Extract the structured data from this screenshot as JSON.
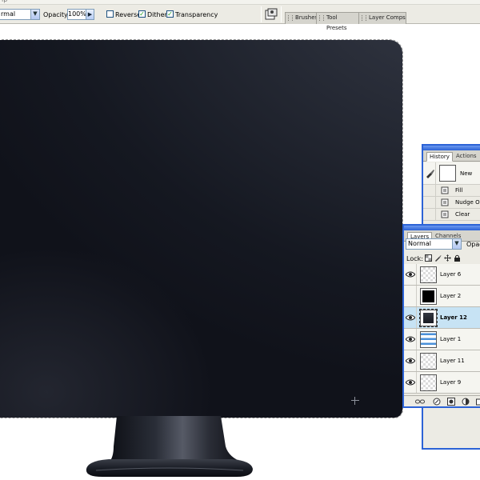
{
  "menu": {
    "fragment": "lp"
  },
  "options_bar": {
    "mode_value": "rmal",
    "opacity_label": "Opacity:",
    "opacity_value": "100%",
    "reverse_label": "Reverse",
    "reverse_checked": false,
    "dither_label": "Dither",
    "dither_checked": true,
    "transparency_label": "Transparency",
    "transparency_checked": true
  },
  "palette_well": {
    "tabs": [
      "Brushes",
      "Tool Presets",
      "Layer Comps"
    ]
  },
  "history": {
    "tabs": [
      "History",
      "Actions"
    ],
    "snapshot_label": "New",
    "steps": [
      "Fill",
      "Nudge Ou",
      "Clear"
    ]
  },
  "layers": {
    "tabs": [
      "Layers",
      "Channels"
    ],
    "blend_mode": "Normal",
    "opacity_label": "Opaci",
    "lock_label": "Lock:",
    "rows": [
      {
        "name": "Layer 6",
        "visible": true,
        "selected": false
      },
      {
        "name": "Layer 2",
        "visible": false,
        "selected": false
      },
      {
        "name": "Layer 12",
        "visible": true,
        "selected": true
      },
      {
        "name": "Layer 1",
        "visible": true,
        "selected": false
      },
      {
        "name": "Layer 11",
        "visible": true,
        "selected": false
      },
      {
        "name": "Layer 9",
        "visible": true,
        "selected": false
      }
    ]
  },
  "colors": {
    "panel_title": "#2c63d6",
    "selected_layer": "#c7e3f4",
    "screen_dark": "#151821"
  }
}
